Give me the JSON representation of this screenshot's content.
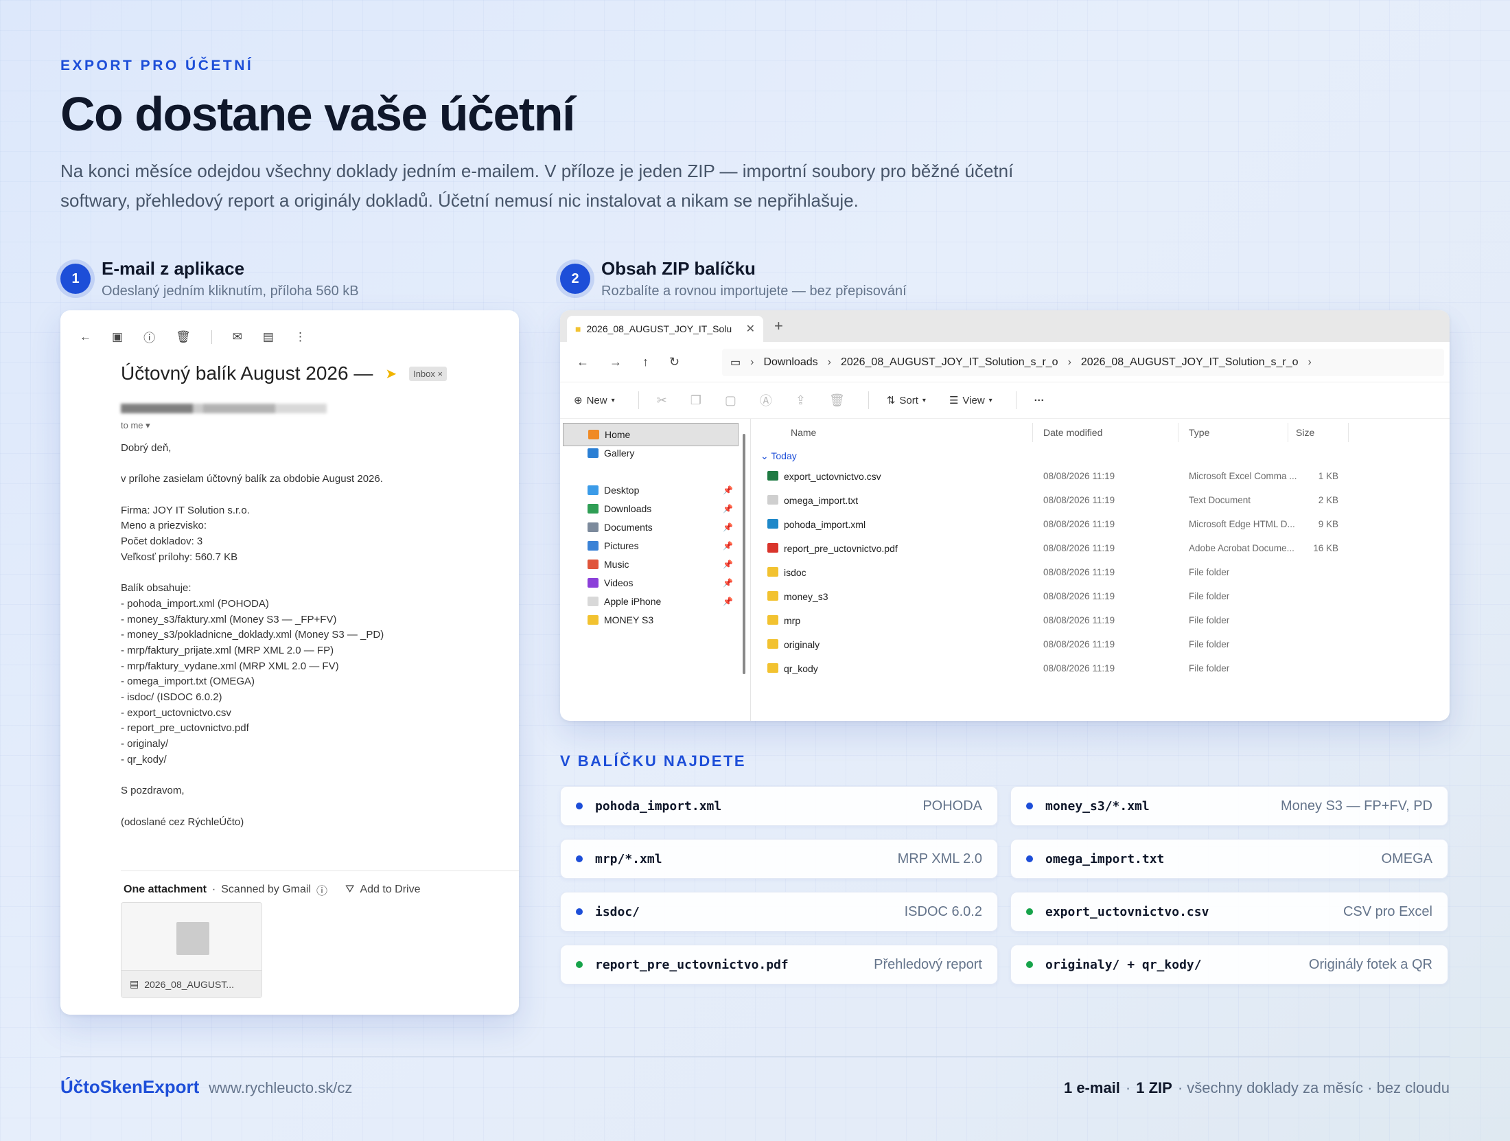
{
  "header": {
    "eyebrow": "EXPORT PRO ÚČETNÍ",
    "title": "Co dostane vaše účetní",
    "subtitle": "Na konci měsíce odejdou všechny doklady jedním e-mailem. V příloze je jeden ZIP — importní soubory pro běžné účetní softwary, přehledový report a originály dokladů. Účetní nemusí nic instalovat a nikam se nepřihlašuje."
  },
  "steps": [
    {
      "number": "1",
      "title": "E-mail z aplikace",
      "subtitle": "Odeslaný jedním kliknutím, příloha 560 kB"
    },
    {
      "number": "2",
      "title": "Obsah ZIP balíčku",
      "subtitle": "Rozbalíte a rovnou importujete — bez přepisování"
    }
  ],
  "email": {
    "toolbar_icons": [
      "back-icon",
      "archive-icon",
      "report-icon",
      "delete-icon",
      "mark-unread-icon",
      "move-icon",
      "more-icon"
    ],
    "subject": "Účtovný balík August 2026 —",
    "label": "Inbox ×",
    "to": "to me ▾",
    "body_lines": [
      "Dobrý deň,",
      "",
      "v prílohe zasielam účtovný balík za obdobie August 2026.",
      "",
      "Firma: JOY IT Solution s.r.o.",
      "Meno a priezvisko:",
      "Počet dokladov: 3",
      "Veľkosť prílohy: 560.7 KB",
      "",
      "Balík obsahuje:",
      "- pohoda_import.xml (POHODA)",
      "- money_s3/faktury.xml (Money S3 — _FP+FV)",
      "- money_s3/pokladnicne_doklady.xml (Money S3 — _PD)",
      "- mrp/faktury_prijate.xml (MRP XML 2.0 — FP)",
      "- mrp/faktury_vydane.xml (MRP XML 2.0 — FV)",
      "- omega_import.txt (OMEGA)",
      "- isdoc/ (ISDOC 6.0.2)",
      "- export_uctovnictvo.csv",
      "- report_pre_uctovnictvo.pdf",
      "- originaly/",
      "- qr_kody/",
      "",
      "S pozdravom,",
      "",
      "(odoslané cez RýchleÚčto)"
    ],
    "attachment_count": "One attachment",
    "scanned": "Scanned by Gmail",
    "add_to_drive": "Add to Drive",
    "attachment_name": "2026_08_AUGUST..."
  },
  "explorer": {
    "tab_title": "2026_08_AUGUST_JOY_IT_Solu",
    "breadcrumb": [
      "Downloads",
      "2026_08_AUGUST_JOY_IT_Solution_s_r_o",
      "2026_08_AUGUST_JOY_IT_Solution_s_r_o"
    ],
    "commands": {
      "new": "New",
      "sort": "Sort",
      "view": "View",
      "more": "···"
    },
    "nav": [
      {
        "label": "Home",
        "color": "#f08a24",
        "pinned": false
      },
      {
        "label": "Gallery",
        "color": "#2a7fd4",
        "pinned": false
      },
      {
        "label": "Desktop",
        "color": "#3b9be8",
        "pinned": true
      },
      {
        "label": "Downloads",
        "color": "#2f9e55",
        "pinned": true
      },
      {
        "label": "Documents",
        "color": "#7c8a9c",
        "pinned": true
      },
      {
        "label": "Pictures",
        "color": "#3b82d6",
        "pinned": true
      },
      {
        "label": "Music",
        "color": "#e0553b",
        "pinned": true
      },
      {
        "label": "Videos",
        "color": "#8b3fd9",
        "pinned": true
      },
      {
        "label": "Apple iPhone",
        "color": "#d8d8d8",
        "pinned": true
      },
      {
        "label": "MONEY S3",
        "color": "#f2c230",
        "pinned": false
      }
    ],
    "columns": {
      "name": "Name",
      "date": "Date modified",
      "type": "Type",
      "size": "Size"
    },
    "group": "Today",
    "files": [
      {
        "name": "export_uctovnictvo.csv",
        "date": "08/08/2026 11:19",
        "type": "Microsoft Excel Comma ...",
        "size": "1 KB",
        "color": "#1f7a43"
      },
      {
        "name": "omega_import.txt",
        "date": "08/08/2026 11:19",
        "type": "Text Document",
        "size": "2 KB",
        "color": "#cfcfcf"
      },
      {
        "name": "pohoda_import.xml",
        "date": "08/08/2026 11:19",
        "type": "Microsoft Edge HTML D...",
        "size": "9 KB",
        "color": "#1e88c9"
      },
      {
        "name": "report_pre_uctovnictvo.pdf",
        "date": "08/08/2026 11:19",
        "type": "Adobe Acrobat Docume...",
        "size": "16 KB",
        "color": "#d9342b"
      },
      {
        "name": "isdoc",
        "date": "08/08/2026 11:19",
        "type": "File folder",
        "size": "",
        "color": "#f2c230"
      },
      {
        "name": "money_s3",
        "date": "08/08/2026 11:19",
        "type": "File folder",
        "size": "",
        "color": "#f2c230"
      },
      {
        "name": "mrp",
        "date": "08/08/2026 11:19",
        "type": "File folder",
        "size": "",
        "color": "#f2c230"
      },
      {
        "name": "originaly",
        "date": "08/08/2026 11:19",
        "type": "File folder",
        "size": "",
        "color": "#f2c230"
      },
      {
        "name": "qr_kody",
        "date": "08/08/2026 11:19",
        "type": "File folder",
        "size": "",
        "color": "#f2c230"
      }
    ]
  },
  "package": {
    "heading": "V BALÍČKU NAJDETE",
    "items": [
      {
        "file": "pohoda_import.xml",
        "desc": "POHODA",
        "dot": "#1d4ed8"
      },
      {
        "file": "money_s3/*.xml",
        "desc": "Money S3 — FP+FV, PD",
        "dot": "#1d4ed8"
      },
      {
        "file": "mrp/*.xml",
        "desc": "MRP XML 2.0",
        "dot": "#1d4ed8"
      },
      {
        "file": "omega_import.txt",
        "desc": "OMEGA",
        "dot": "#1d4ed8"
      },
      {
        "file": "isdoc/",
        "desc": "ISDOC 6.0.2",
        "dot": "#1d4ed8"
      },
      {
        "file": "export_uctovnictvo.csv",
        "desc": "CSV pro Excel",
        "dot": "#16a34a"
      },
      {
        "file": "report_pre_uctovnictvo.pdf",
        "desc": "Přehledový report",
        "dot": "#16a34a"
      },
      {
        "file": "originaly/ + qr_kody/",
        "desc": "Originály fotek a QR",
        "dot": "#16a34a"
      }
    ]
  },
  "footer": {
    "brand": "ÚčtoSkenExport",
    "url": "www.rychleucto.sk/cz",
    "stat1": "1 e-mail",
    "sep1": "·",
    "stat2": "1 ZIP",
    "rest": "· všechny doklady za měsíc · bez cloudu"
  }
}
